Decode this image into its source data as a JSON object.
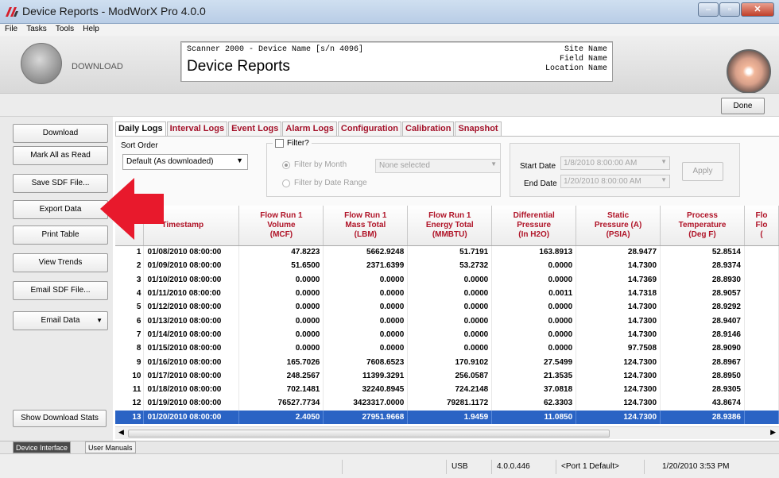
{
  "window": {
    "title": "Device Reports - ModWorX Pro 4.0.0",
    "min": "–",
    "max": "▫",
    "close": "✕"
  },
  "menu": [
    "File",
    "Tasks",
    "Tools",
    "Help"
  ],
  "header": {
    "download_label": "DOWNLOAD",
    "device_line": "Scanner 2000 - Device Name [s/n 4096]",
    "page_title": "Device Reports",
    "site": "Site Name",
    "field": "Field Name",
    "location": "Location Name"
  },
  "toolbar": {
    "done": "Done"
  },
  "left": {
    "download": "Download",
    "mark_read": "Mark All as Read",
    "save_sdf": "Save SDF File...",
    "export": "Export Data",
    "print": "Print Table",
    "trends": "View Trends",
    "email_sdf": "Email SDF File...",
    "email_data": "Email Data",
    "show_stats": "Show Download Stats"
  },
  "tabs": [
    "Daily Logs",
    "Interval Logs",
    "Event Logs",
    "Alarm Logs",
    "Configuration",
    "Calibration",
    "Snapshot"
  ],
  "filters": {
    "sort_label": "Sort Order",
    "sort_value": "Default (As downloaded)",
    "filter_label": "Filter?",
    "by_month": "Filter by Month",
    "by_date": "Filter by Date Range",
    "month_value": "None selected",
    "start_label": "Start Date",
    "start_value": "1/8/2010 8:00:00 AM",
    "end_label": "End Date",
    "end_value": "1/20/2010 8:00:00 AM",
    "apply": "Apply"
  },
  "table": {
    "headers": [
      [
        "Re",
        ""
      ],
      [
        "Timestamp"
      ],
      [
        "Flow Run 1",
        "Volume",
        "(MCF)"
      ],
      [
        "Flow Run 1",
        "Mass Total",
        "(LBM)"
      ],
      [
        "Flow Run 1",
        "Energy Total",
        "(MMBTU)"
      ],
      [
        "Differential",
        "Pressure",
        "(In H2O)"
      ],
      [
        "Static",
        "Pressure (A)",
        "(PSIA)"
      ],
      [
        "Process",
        "Temperature",
        "(Deg F)"
      ],
      [
        "Flo",
        "Flo",
        "("
      ]
    ],
    "rows": [
      [
        "1",
        "01/08/2010 08:00:00",
        "47.8223",
        "5662.9248",
        "51.7191",
        "163.8913",
        "28.9477",
        "52.8514"
      ],
      [
        "2",
        "01/09/2010 08:00:00",
        "51.6500",
        "2371.6399",
        "53.2732",
        "0.0000",
        "14.7300",
        "28.9374"
      ],
      [
        "3",
        "01/10/2010 08:00:00",
        "0.0000",
        "0.0000",
        "0.0000",
        "0.0000",
        "14.7369",
        "28.8930"
      ],
      [
        "4",
        "01/11/2010 08:00:00",
        "0.0000",
        "0.0000",
        "0.0000",
        "0.0011",
        "14.7318",
        "28.9057"
      ],
      [
        "5",
        "01/12/2010 08:00:00",
        "0.0000",
        "0.0000",
        "0.0000",
        "0.0000",
        "14.7300",
        "28.9292"
      ],
      [
        "6",
        "01/13/2010 08:00:00",
        "0.0000",
        "0.0000",
        "0.0000",
        "0.0000",
        "14.7300",
        "28.9407"
      ],
      [
        "7",
        "01/14/2010 08:00:00",
        "0.0000",
        "0.0000",
        "0.0000",
        "0.0000",
        "14.7300",
        "28.9146"
      ],
      [
        "8",
        "01/15/2010 08:00:00",
        "0.0000",
        "0.0000",
        "0.0000",
        "0.0000",
        "97.7508",
        "28.9090"
      ],
      [
        "9",
        "01/16/2010 08:00:00",
        "165.7026",
        "7608.6523",
        "170.9102",
        "27.5499",
        "124.7300",
        "28.8967"
      ],
      [
        "10",
        "01/17/2010 08:00:00",
        "248.2567",
        "11399.3291",
        "256.0587",
        "21.3535",
        "124.7300",
        "28.8950"
      ],
      [
        "11",
        "01/18/2010 08:00:00",
        "702.1481",
        "32240.8945",
        "724.2148",
        "37.0818",
        "124.7300",
        "28.9305"
      ],
      [
        "12",
        "01/19/2010 08:00:00",
        "76527.7734",
        "3423317.0000",
        "79281.1172",
        "62.3303",
        "124.7300",
        "43.8674"
      ],
      [
        "13",
        "01/20/2010 08:00:00",
        "2.4050",
        "27951.9668",
        "1.9459",
        "11.0850",
        "124.7300",
        "28.9386"
      ]
    ],
    "selected_row": 12
  },
  "scroll": {
    "left": "◀",
    "right": "▶",
    "grip": "|||"
  },
  "bottom_tabs": [
    "Device Interface",
    "User Manuals"
  ],
  "status": {
    "port_type": "USB",
    "version": "4.0.0.446",
    "port": "<Port 1 Default>",
    "datetime": "1/20/2010 3:53 PM"
  },
  "colors": {
    "tab_text": "#a4122a",
    "header_text": "#b01428",
    "selected_row": "#2a63c4",
    "arrow": "#e8192c"
  }
}
